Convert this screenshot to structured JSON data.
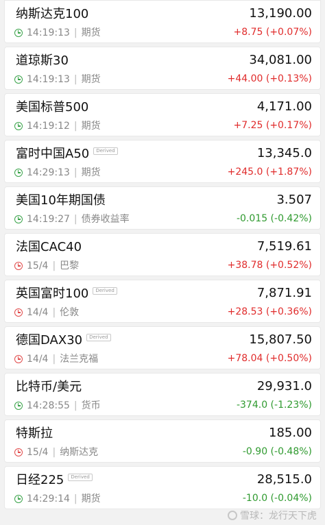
{
  "items": [
    {
      "name": "纳斯达克100",
      "badge": "",
      "price": "13,190.00",
      "time": "14:19:13",
      "market": "期货",
      "change": "+8.75 (+0.07%)",
      "dir": "up",
      "clock": "green"
    },
    {
      "name": "道琼斯30",
      "badge": "",
      "price": "34,081.00",
      "time": "14:19:13",
      "market": "期货",
      "change": "+44.00 (+0.13%)",
      "dir": "up",
      "clock": "green"
    },
    {
      "name": "美国标普500",
      "badge": "",
      "price": "4,171.00",
      "time": "14:19:12",
      "market": "期货",
      "change": "+7.25 (+0.17%)",
      "dir": "up",
      "clock": "green"
    },
    {
      "name": "富时中国A50",
      "badge": "Derived",
      "price": "13,345.0",
      "time": "14:29:13",
      "market": "期货",
      "change": "+245.0 (+1.87%)",
      "dir": "up",
      "clock": "green"
    },
    {
      "name": "美国10年期国债",
      "badge": "",
      "price": "3.507",
      "time": "14:19:27",
      "market": "债券收益率",
      "change": "-0.015 (-0.42%)",
      "dir": "down",
      "clock": "green"
    },
    {
      "name": "法国CAC40",
      "badge": "",
      "price": "7,519.61",
      "time": "15/4",
      "market": "巴黎",
      "change": "+38.78 (+0.52%)",
      "dir": "up",
      "clock": "red"
    },
    {
      "name": "英国富时100",
      "badge": "Derived",
      "price": "7,871.91",
      "time": "14/4",
      "market": "伦敦",
      "change": "+28.53 (+0.36%)",
      "dir": "up",
      "clock": "red"
    },
    {
      "name": "德国DAX30",
      "badge": "Derived",
      "price": "15,807.50",
      "time": "14/4",
      "market": "法兰克福",
      "change": "+78.04 (+0.50%)",
      "dir": "up",
      "clock": "red"
    },
    {
      "name": "比特币/美元",
      "badge": "",
      "price": "29,931.0",
      "time": "14:28:55",
      "market": "货币",
      "change": "-374.0 (-1.23%)",
      "dir": "down",
      "clock": "green"
    },
    {
      "name": "特斯拉",
      "badge": "",
      "price": "185.00",
      "time": "15/4",
      "market": "纳斯达克",
      "change": "-0.90 (-0.48%)",
      "dir": "down",
      "clock": "red"
    },
    {
      "name": "日经225",
      "badge": "Derived",
      "price": "28,515.0",
      "time": "14:29:14",
      "market": "期货",
      "change": "-10.0 (-0.04%)",
      "dir": "down",
      "clock": "green"
    }
  ],
  "separator": "|",
  "watermark": "雪球：龙行天下虎",
  "colors": {
    "up": "#e02b2b",
    "down": "#2f9a2f",
    "clock_green": "#3aa34a",
    "clock_red": "#e14b4b"
  }
}
